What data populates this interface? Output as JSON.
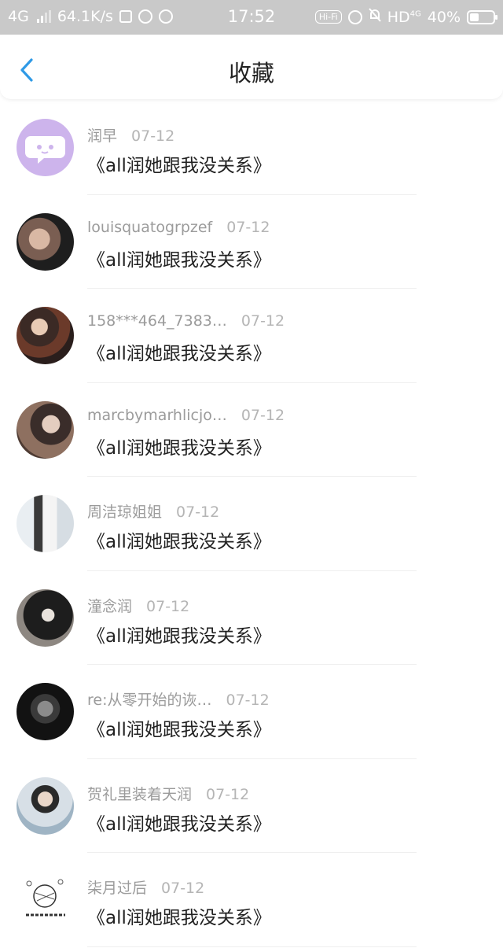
{
  "status_bar": {
    "network": "4G",
    "speed": "64.1K/s",
    "time": "17:52",
    "hifi": "Hi-Fi",
    "hd": "HD",
    "hd_sup": "4G",
    "battery": "40%",
    "battery_level": 0.4
  },
  "header": {
    "title": "收藏",
    "accent_color": "#2f9ae6"
  },
  "items": [
    {
      "user": "润早",
      "date": "07-12",
      "title": "《all润她跟我没关系》",
      "avatar": "bubble-icon"
    },
    {
      "user": "louisquatogrpzef",
      "date": "07-12",
      "title": "《all润她跟我没关系》",
      "avatar": "photo"
    },
    {
      "user": "158***464_7383…",
      "date": "07-12",
      "title": "《all润她跟我没关系》",
      "avatar": "photo"
    },
    {
      "user": "marcbymarhlicjo…",
      "date": "07-12",
      "title": "《all润她跟我没关系》",
      "avatar": "photo"
    },
    {
      "user": "周洁琼姐姐",
      "date": "07-12",
      "title": "《all润她跟我没关系》",
      "avatar": "photo"
    },
    {
      "user": "潼念润",
      "date": "07-12",
      "title": "《all润她跟我没关系》",
      "avatar": "photo"
    },
    {
      "user": "re:从零开始的诙…",
      "date": "07-12",
      "title": "《all润她跟我没关系》",
      "avatar": "skull"
    },
    {
      "user": "贺礼里装着天润",
      "date": "07-12",
      "title": "《all润她跟我没关系》",
      "avatar": "photo"
    },
    {
      "user": "柒月过后",
      "date": "07-12",
      "title": "《all润她跟我没关系》",
      "avatar": "doodle"
    }
  ]
}
